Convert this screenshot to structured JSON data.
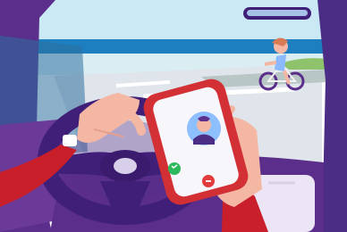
{
  "scene": {
    "palette": {
      "sky": "#cbe8f5",
      "sea": "#1d7fc0",
      "car_interior": "#5a2e8a",
      "steering_wheel": "#3f1f77",
      "sleeve": "#c91f2b",
      "phone_body": "#d33035",
      "screen": "#f7f7fb",
      "accept": "#2eb85c",
      "decline": "#e23b3b"
    },
    "icons": [
      "steering-wheel-icon",
      "smartphone-icon",
      "contact-avatar-icon",
      "accept-call-icon",
      "decline-call-icon",
      "rear-view-mirror-icon",
      "bicycle-icon"
    ]
  }
}
